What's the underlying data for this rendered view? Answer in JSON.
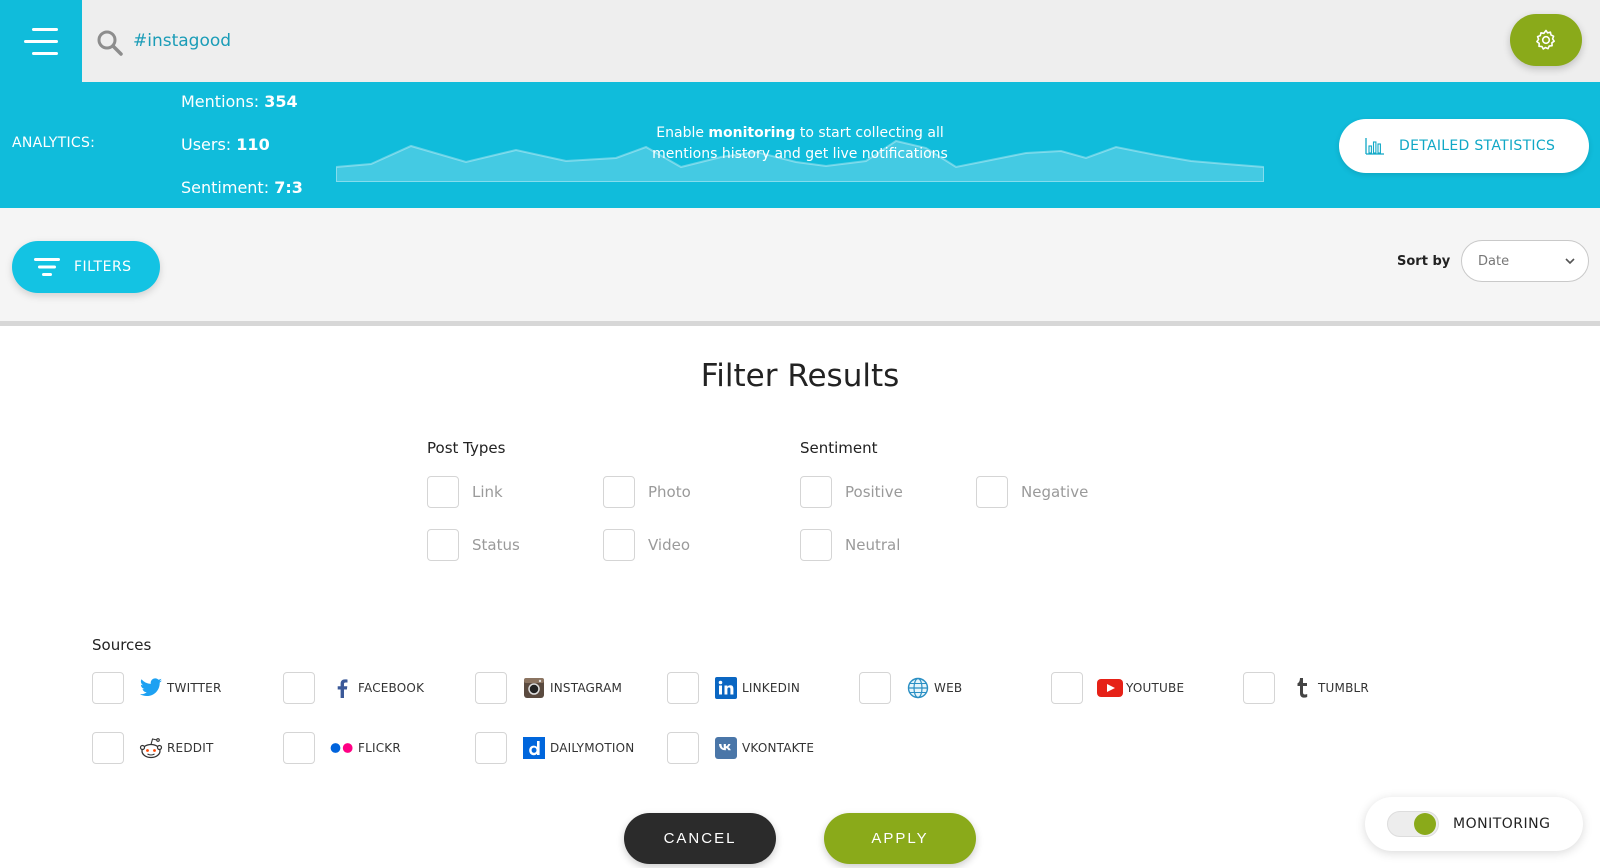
{
  "topbar": {
    "search_value": "#instagood",
    "menu_icon": "hamburger-menu-icon",
    "search_icon": "search-icon",
    "settings_icon": "gear-icon"
  },
  "analytics": {
    "label": "ANALYTICS:",
    "mentions_label": "Mentions:",
    "mentions_value": "354",
    "users_label": "Users:",
    "users_value": "110",
    "sentiment_label": "Sentiment:",
    "sentiment_value": "7:3",
    "monitor_msg_pre": "Enable ",
    "monitor_msg_bold": "monitoring",
    "monitor_msg_post": " to start collecting all mentions history and get live notifications",
    "detailed_stats_label": "DETAILED STATISTICS"
  },
  "toolbar": {
    "filters_label": "FILTERS",
    "sort_label": "Sort by",
    "sort_value": "Date"
  },
  "panel": {
    "title": "Filter Results",
    "post_types": {
      "title": "Post Types",
      "items": [
        "Link",
        "Photo",
        "Status",
        "Video"
      ]
    },
    "sentiment": {
      "title": "Sentiment",
      "items": [
        "Positive",
        "Negative",
        "Neutral"
      ]
    },
    "sources": {
      "title": "Sources",
      "items": [
        "TWITTER",
        "FACEBOOK",
        "INSTAGRAM",
        "LINKEDIN",
        "WEB",
        "YOUTUBE",
        "TUMBLR",
        "REDDIT",
        "FLICKR",
        "DAILYMOTION",
        "VKONTAKTE"
      ]
    },
    "cancel_label": "CANCEL",
    "apply_label": "APPLY"
  },
  "monitoring": {
    "label": "MONITORING",
    "enabled": true
  },
  "colors": {
    "accent": "#10bcdb",
    "green": "#8aaa1a",
    "dark": "#2b2b2b"
  }
}
